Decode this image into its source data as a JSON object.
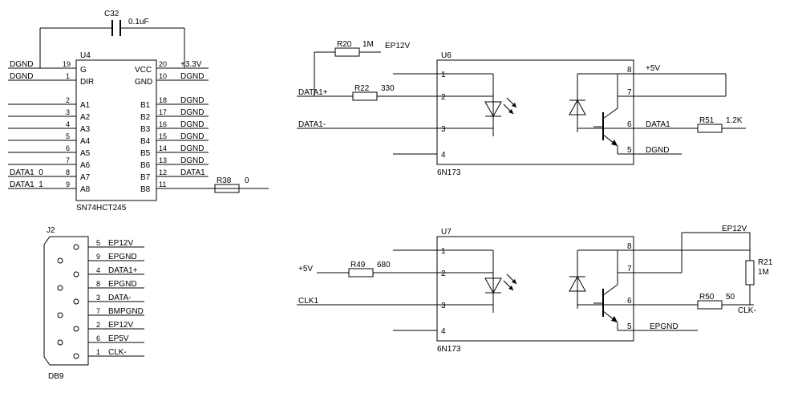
{
  "c32": {
    "ref": "C32",
    "val": "0.1uF"
  },
  "u4": {
    "ref": "U4",
    "part": "SN74HCT245",
    "left": [
      {
        "num": "19",
        "name": "G",
        "net": "DGND"
      },
      {
        "num": "1",
        "name": "DIR",
        "net": "DGND"
      },
      {
        "num": "2",
        "name": "A1",
        "net": ""
      },
      {
        "num": "3",
        "name": "A2",
        "net": ""
      },
      {
        "num": "4",
        "name": "A3",
        "net": ""
      },
      {
        "num": "5",
        "name": "A4",
        "net": ""
      },
      {
        "num": "6",
        "name": "A5",
        "net": ""
      },
      {
        "num": "7",
        "name": "A6",
        "net": ""
      },
      {
        "num": "8",
        "name": "A7",
        "net": "DATA1_0"
      },
      {
        "num": "9",
        "name": "A8",
        "net": "DATA1_1"
      }
    ],
    "right": [
      {
        "num": "20",
        "name": "VCC",
        "net": "+3.3V"
      },
      {
        "num": "10",
        "name": "GND",
        "net": "DGND"
      },
      {
        "num": "18",
        "name": "B1",
        "net": "DGND"
      },
      {
        "num": "17",
        "name": "B2",
        "net": "DGND"
      },
      {
        "num": "16",
        "name": "B3",
        "net": "DGND"
      },
      {
        "num": "15",
        "name": "B4",
        "net": "DGND"
      },
      {
        "num": "14",
        "name": "B5",
        "net": "DGND"
      },
      {
        "num": "13",
        "name": "B6",
        "net": "DGND"
      },
      {
        "num": "12",
        "name": "B7",
        "net": "DATA1"
      },
      {
        "num": "11",
        "name": "B8",
        "net": ""
      }
    ]
  },
  "r38": {
    "ref": "R38",
    "val": "0"
  },
  "j2": {
    "ref": "J2",
    "part": "DB9",
    "pins": [
      {
        "num": "5",
        "net": "EP12V"
      },
      {
        "num": "9",
        "net": "EPGND"
      },
      {
        "num": "4",
        "net": "DATA1+"
      },
      {
        "num": "8",
        "net": "EPGND"
      },
      {
        "num": "3",
        "net": "DATA-"
      },
      {
        "num": "7",
        "net": "BMPGND"
      },
      {
        "num": "2",
        "net": "EP12V"
      },
      {
        "num": "6",
        "net": "EP5V"
      },
      {
        "num": "1",
        "net": "CLK-"
      }
    ]
  },
  "u6": {
    "ref": "U6",
    "part": "6N173",
    "left": [
      {
        "num": "1",
        "net": ""
      },
      {
        "num": "2",
        "net": "DATA1+"
      },
      {
        "num": "3",
        "net": "DATA1-"
      },
      {
        "num": "4",
        "net": ""
      }
    ],
    "right": [
      {
        "num": "8",
        "net": "+5V"
      },
      {
        "num": "7",
        "net": ""
      },
      {
        "num": "6",
        "net": "DATA1"
      },
      {
        "num": "5",
        "net": "DGND"
      }
    ]
  },
  "u7": {
    "ref": "U7",
    "part": "6N173",
    "left": [
      {
        "num": "1",
        "net": ""
      },
      {
        "num": "2",
        "net": "+5V"
      },
      {
        "num": "3",
        "net": "CLK1"
      },
      {
        "num": "4",
        "net": ""
      }
    ],
    "right": [
      {
        "num": "8",
        "net": ""
      },
      {
        "num": "7",
        "net": ""
      },
      {
        "num": "6",
        "net": ""
      },
      {
        "num": "5",
        "net": "EPGND"
      }
    ]
  },
  "r20": {
    "ref": "R20",
    "val": "1M",
    "net": "EP12V"
  },
  "r22": {
    "ref": "R22",
    "val": "330"
  },
  "r51": {
    "ref": "R51",
    "val": "1.2K"
  },
  "r49": {
    "ref": "R49",
    "val": "680"
  },
  "r50": {
    "ref": "R50",
    "val": "50",
    "net": "CLK-"
  },
  "r21": {
    "ref": "R21",
    "val": "1M",
    "net": "EP12V"
  }
}
